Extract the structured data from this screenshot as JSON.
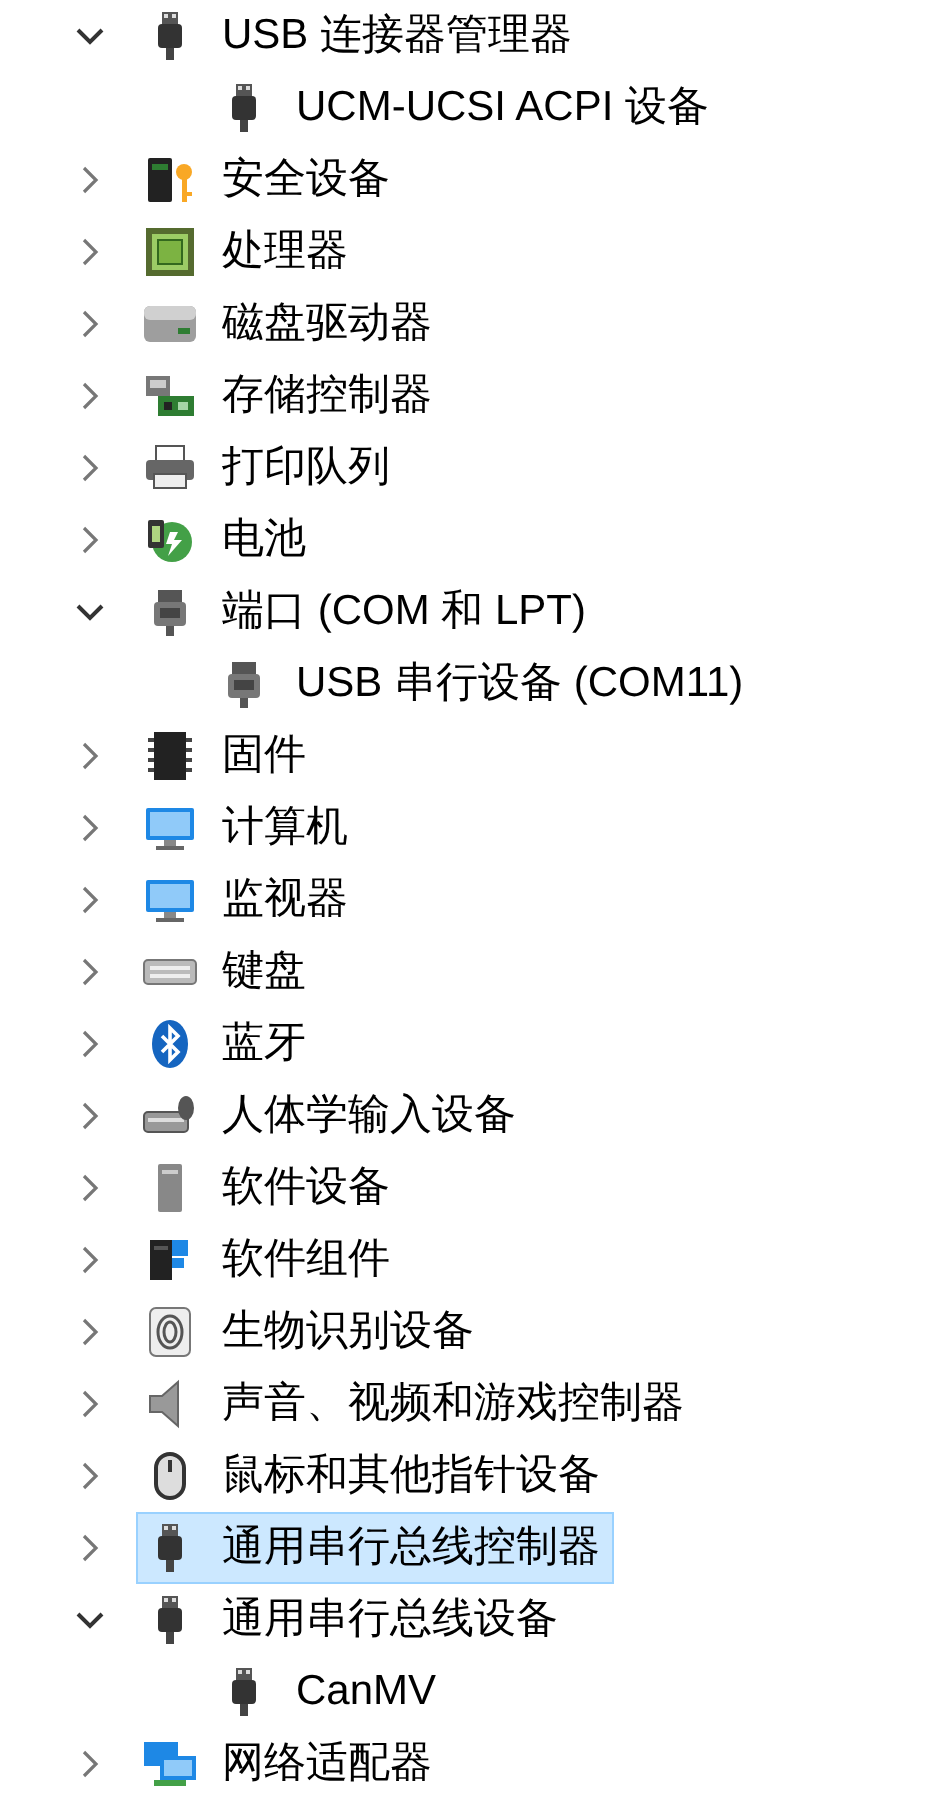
{
  "tree": [
    {
      "label": "USB 连接器管理器",
      "expanded": true,
      "selected": false,
      "children": [
        {
          "label": "UCM-UCSI ACPI 设备",
          "selected": false
        }
      ]
    },
    {
      "label": "安全设备",
      "expanded": false,
      "selected": false
    },
    {
      "label": "处理器",
      "expanded": false,
      "selected": false
    },
    {
      "label": "磁盘驱动器",
      "expanded": false,
      "selected": false
    },
    {
      "label": "存储控制器",
      "expanded": false,
      "selected": false
    },
    {
      "label": "打印队列",
      "expanded": false,
      "selected": false
    },
    {
      "label": "电池",
      "expanded": false,
      "selected": false
    },
    {
      "label": "端口 (COM 和 LPT)",
      "expanded": true,
      "selected": false,
      "children": [
        {
          "label": "USB 串行设备 (COM11)",
          "selected": false
        }
      ]
    },
    {
      "label": "固件",
      "expanded": false,
      "selected": false
    },
    {
      "label": "计算机",
      "expanded": false,
      "selected": false
    },
    {
      "label": "监视器",
      "expanded": false,
      "selected": false
    },
    {
      "label": "键盘",
      "expanded": false,
      "selected": false
    },
    {
      "label": "蓝牙",
      "expanded": false,
      "selected": false
    },
    {
      "label": "人体学输入设备",
      "expanded": false,
      "selected": false
    },
    {
      "label": "软件设备",
      "expanded": false,
      "selected": false
    },
    {
      "label": "软件组件",
      "expanded": false,
      "selected": false
    },
    {
      "label": "生物识别设备",
      "expanded": false,
      "selected": false
    },
    {
      "label": "声音、视频和游戏控制器",
      "expanded": false,
      "selected": false
    },
    {
      "label": "鼠标和其他指针设备",
      "expanded": false,
      "selected": false
    },
    {
      "label": "通用串行总线控制器",
      "expanded": false,
      "selected": true
    },
    {
      "label": "通用串行总线设备",
      "expanded": true,
      "selected": false,
      "children": [
        {
          "label": "CanMV",
          "selected": false
        }
      ]
    },
    {
      "label": "网络适配器",
      "expanded": false,
      "selected": false
    }
  ]
}
